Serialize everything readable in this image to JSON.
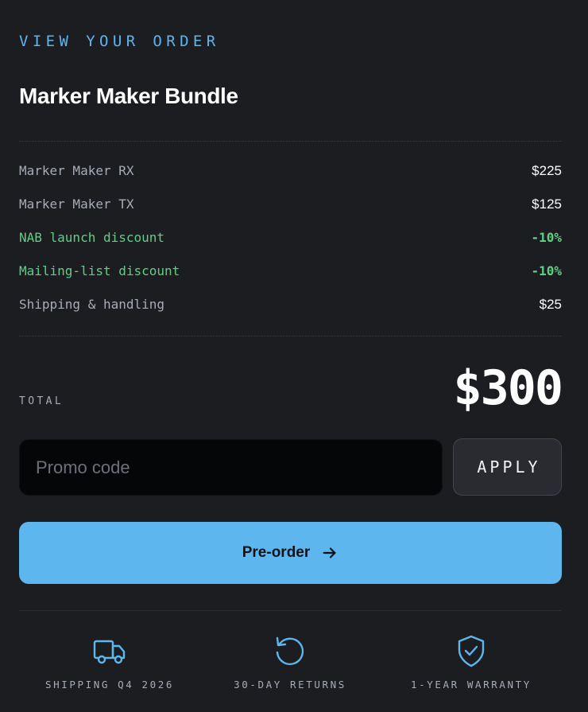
{
  "header": {
    "eyebrow": "VIEW YOUR ORDER",
    "title": "Marker Maker Bundle"
  },
  "line_items": [
    {
      "label": "Marker Maker RX",
      "value": "$225",
      "type": "item"
    },
    {
      "label": "Marker Maker TX",
      "value": "$125",
      "type": "item"
    },
    {
      "label": "NAB launch discount",
      "value": "-10%",
      "type": "discount"
    },
    {
      "label": "Mailing-list discount",
      "value": "-10%",
      "type": "discount"
    },
    {
      "label": "Shipping & handling",
      "value": "$25",
      "type": "item"
    }
  ],
  "total": {
    "label": "TOTAL",
    "value": "$300"
  },
  "promo": {
    "placeholder": "Promo code",
    "value": "",
    "apply_label": "APPLY"
  },
  "cta": {
    "label": "Pre-order",
    "icon": "arrow-right-icon"
  },
  "features": [
    {
      "icon": "truck-icon",
      "label": "SHIPPING Q4 2026"
    },
    {
      "icon": "rotate-ccw-icon",
      "label": "30-DAY RETURNS"
    },
    {
      "icon": "shield-check-icon",
      "label": "1-YEAR WARRANTY"
    }
  ],
  "colors": {
    "background": "#1c1d21",
    "accent": "#5db6ee",
    "discount": "#5fcf86",
    "muted_text": "#a7acb6",
    "input_background": "#050608"
  }
}
